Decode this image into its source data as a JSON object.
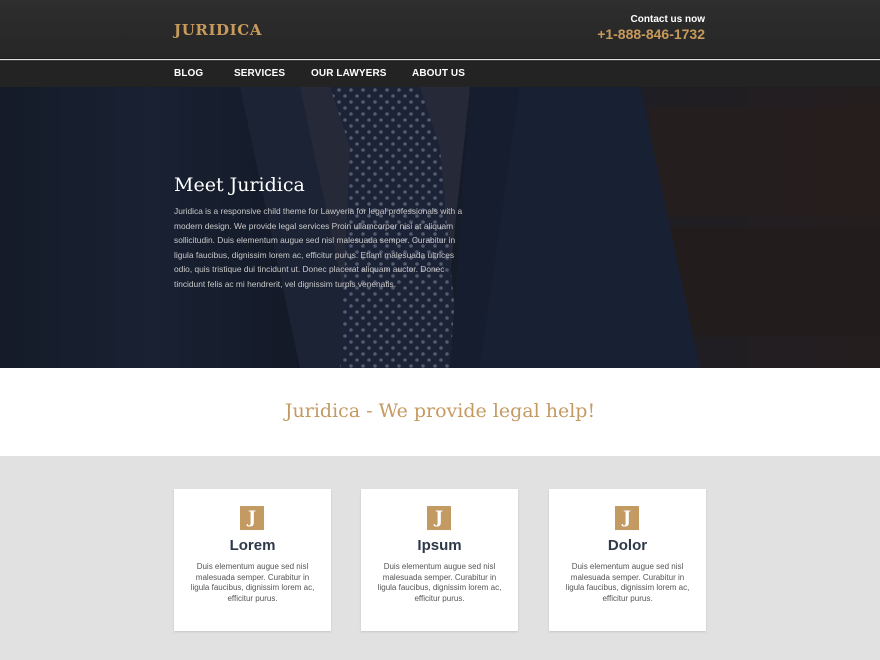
{
  "header": {
    "logo": "JURIDICA",
    "contact_label": "Contact us now",
    "contact_phone": "+1-888-846-1732"
  },
  "nav": {
    "items": [
      "BLOG",
      "SERVICES",
      "OUR LAWYERS",
      "ABOUT US"
    ]
  },
  "hero": {
    "title": "Meet Juridica",
    "text": "Juridica is a responsive child theme for Lawyeria for legal professionals with a modern design. We provide legal services Proin ullamcorper nisi at aliquam sollicitudin. Duis elementum augue sed nisl malesuada semper. Curabitur in ligula faucibus, dignissim lorem ac, efficitur purus. Etiam malesuada ultrices odio, quis tristique dui tincidunt ut. Donec placerat aliquam auctor. Donec tincidunt felis ac mi hendrerit, vel dignissim turpis venenatis."
  },
  "tagline": "Juridica - We provide legal help!",
  "cards": [
    {
      "icon_letter": "J",
      "title": "Lorem",
      "text": "Duis elementum augue sed nisl malesuada semper. Curabitur in ligula faucibus, dignissim lorem ac, efficitur purus."
    },
    {
      "icon_letter": "J",
      "title": "Ipsum",
      "text": "Duis elementum augue sed nisl malesuada semper. Curabitur in ligula faucibus, dignissim lorem ac, efficitur purus."
    },
    {
      "icon_letter": "J",
      "title": "Dolor",
      "text": "Duis elementum augue sed nisl malesuada semper. Curabitur in ligula faucibus, dignissim lorem ac, efficitur purus."
    }
  ],
  "colors": {
    "accent": "#c49a63",
    "header_bg": "#2a2a2a",
    "nav_bg": "#232323",
    "card_title": "#2d3849"
  }
}
